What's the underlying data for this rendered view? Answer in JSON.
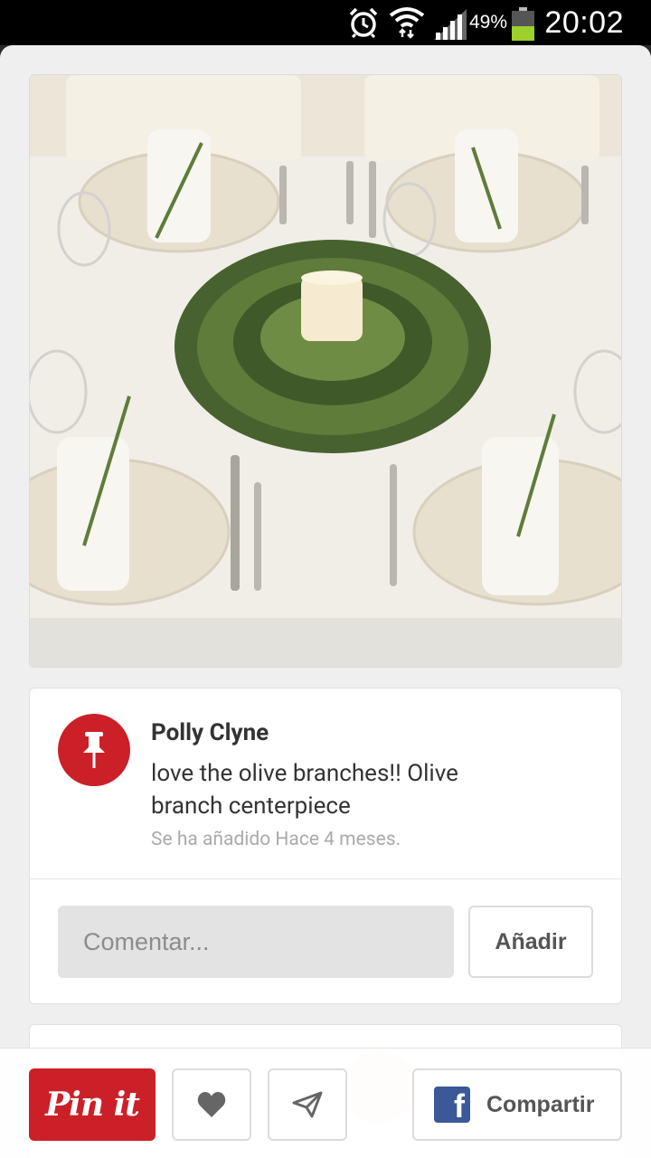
{
  "status_bar": {
    "battery_percent": "49%",
    "time": "20:02",
    "icons": [
      "alarm-icon",
      "wifi-icon",
      "signal-icon",
      "battery-icon"
    ]
  },
  "pin": {
    "image_alt": "Table setting with olive branch centerpiece",
    "author": "Polly Clyne",
    "description": "love the olive branches!! Olive branch centerpiece",
    "added": "Se ha añadido Hace 4 meses."
  },
  "comment": {
    "placeholder": "Comentar...",
    "add_label": "Añadir"
  },
  "actions": {
    "pinit_label": "Pin it",
    "share_label": "Compartir",
    "icons": [
      "heart-icon",
      "send-icon",
      "facebook-icon"
    ]
  },
  "colors": {
    "pinterest_red": "#cb2027",
    "facebook_blue": "#3b5998",
    "battery_green": "#9bd129"
  }
}
